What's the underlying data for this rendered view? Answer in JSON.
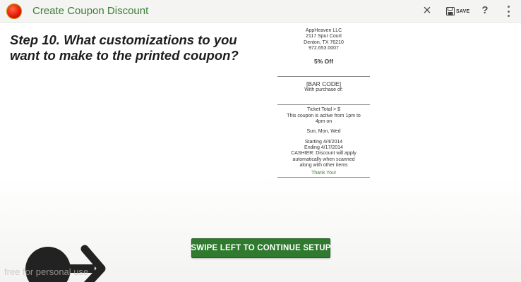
{
  "app_bar": {
    "title": "Create Coupon Discount",
    "save_label": "SAVE",
    "help_label": "?",
    "close_glyph": "×",
    "icons": [
      "app-logo-icon",
      "close-icon",
      "save-icon",
      "help-icon",
      "more-vert-icon"
    ],
    "accent_color": "#3a7d34"
  },
  "step": {
    "heading": "Step 10. What customizations to you want to make to the printed coupon?"
  },
  "coupon": {
    "business_name": "AppHeaven LLC",
    "address_1": "2117 Spur Court",
    "address_2": "Denton, TX 76210",
    "phone": "972.653.0007",
    "offer": "5% Off",
    "barcode": "[BAR CODE]",
    "purchase_line": "With purchase of:",
    "ticket_total": "Ticket Total > $",
    "active_time": "This coupon is active from 1pm to 4pm on",
    "active_days": "Sun, Mon, Wed",
    "starting": "Starting 4/4/2014",
    "ending": "Ending 4/17/2014",
    "cashier_note": "CASHIER: Discount will apply automatically when scanned along with other items",
    "thanks": "Thank You!"
  },
  "continue_button": {
    "label": "SWIPE LEFT TO CONTINUE SETUP",
    "color": "#2f7a2e"
  },
  "swipe_hint": {
    "icon": "swipe-right-arrow-icon"
  },
  "watermark": {
    "text": "free for personal use"
  }
}
